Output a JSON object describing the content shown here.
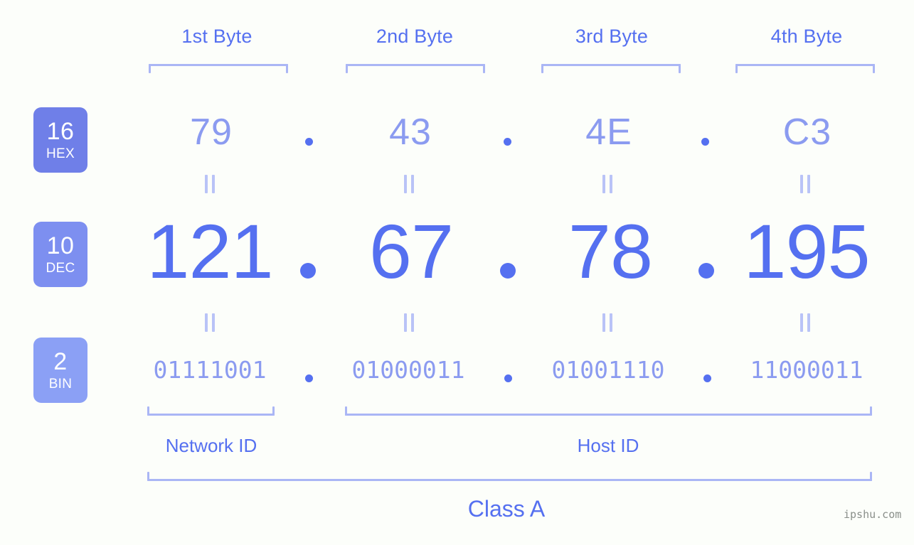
{
  "background_color": "#fcfefa",
  "accent_color": "#5570f0",
  "muted_accent_color": "#8b9bf0",
  "bracket_color": "#aab6f5",
  "byte_headers": [
    {
      "label": "1st Byte"
    },
    {
      "label": "2nd Byte"
    },
    {
      "label": "3rd Byte"
    },
    {
      "label": "4th Byte"
    }
  ],
  "bases": [
    {
      "num": "16",
      "abbr": "HEX",
      "color": "#6f7fe8"
    },
    {
      "num": "10",
      "abbr": "DEC",
      "color": "#7d8ff0"
    },
    {
      "num": "2",
      "abbr": "BIN",
      "color": "#8ba0f5"
    }
  ],
  "rows": {
    "hex": {
      "values": [
        "79",
        "43",
        "4E",
        "C3"
      ],
      "separator": "."
    },
    "dec": {
      "values": [
        "121",
        "67",
        "78",
        "195"
      ],
      "separator": "."
    },
    "bin": {
      "values": [
        "01111001",
        "01000011",
        "01001110",
        "11000011"
      ],
      "separator": "."
    }
  },
  "equals_symbol": "=",
  "segments": {
    "network_id": "Network ID",
    "host_id": "Host ID"
  },
  "class_label": "Class A",
  "watermark": "ipshu.com"
}
